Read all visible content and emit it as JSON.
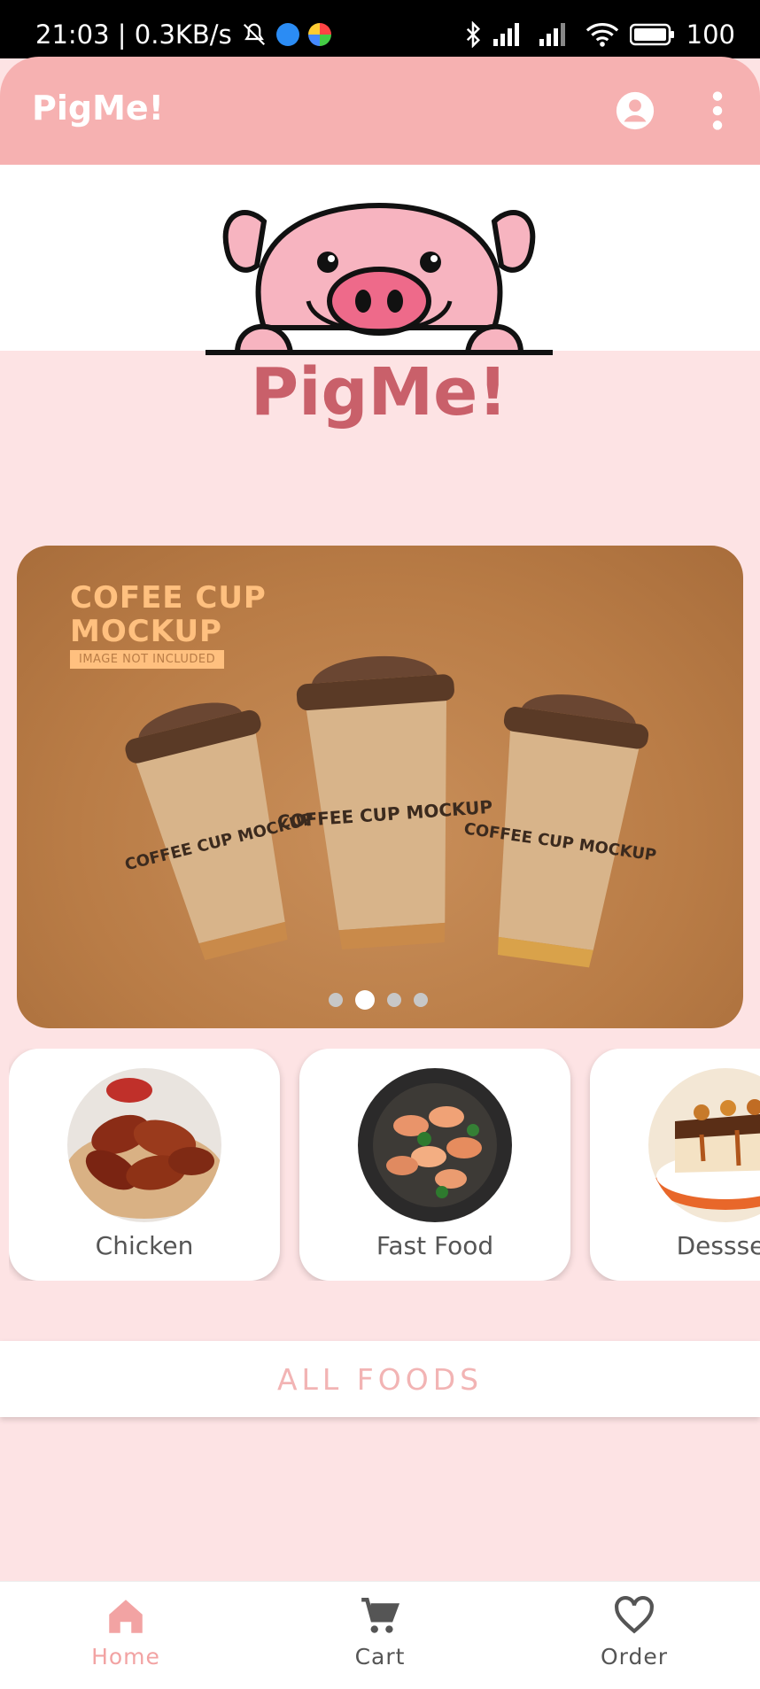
{
  "status_bar": {
    "time_speed": "21:03 | 0.3KB/s",
    "battery": "100"
  },
  "app_bar": {
    "title": "PigMe!",
    "account_icon": "account-circle-icon",
    "menu_icon": "more-vert-icon"
  },
  "logo": {
    "text": "PigMe!"
  },
  "banner": {
    "title": "COFEE CUP\nMOCKUP",
    "tag": "IMAGE NOT INCLUDED",
    "cup_text": "COFFEE CUP MOCKUP",
    "slide_count": 4,
    "active_slide": 2
  },
  "categories": [
    {
      "label": "Chicken"
    },
    {
      "label": "Fast Food"
    },
    {
      "label": "Dessset"
    }
  ],
  "all_foods": {
    "label": "ALL FOODS"
  },
  "bottom_nav": {
    "items": [
      {
        "label": "Home",
        "icon": "home-icon",
        "active": true
      },
      {
        "label": "Cart",
        "icon": "cart-icon",
        "active": false
      },
      {
        "label": "Order",
        "icon": "heart-icon",
        "active": false
      }
    ]
  },
  "colors": {
    "app_bar": "#f6b1b1",
    "background": "#fde3e4",
    "accent": "#f2a3a3",
    "nav_inactive": "#555555"
  }
}
